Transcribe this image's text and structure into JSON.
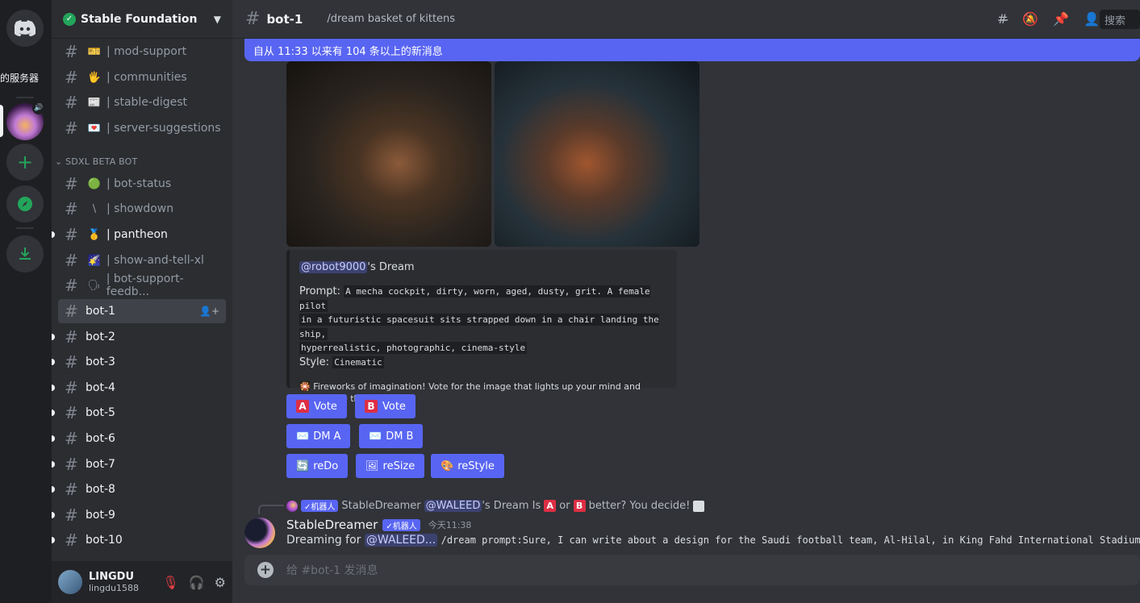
{
  "rail": {
    "server_text": "的服务器"
  },
  "guild": {
    "name": "Stable Foundation"
  },
  "channels_top": [
    {
      "emoji": "🎫",
      "name": "| mod-support"
    },
    {
      "emoji": "🖐",
      "name": "| communities"
    },
    {
      "emoji": "📰",
      "name": "| stable-digest"
    },
    {
      "emoji": "💌",
      "name": "| server-suggestions"
    }
  ],
  "category": "SDXL BETA BOT",
  "channels_bot": [
    {
      "emoji": "🟢",
      "name": "| bot-status"
    },
    {
      "emoji": "\\",
      "name": "| showdown"
    },
    {
      "emoji": "🥇",
      "name": "| pantheon"
    },
    {
      "emoji": "🌠",
      "name": "| show-and-tell-xl"
    },
    {
      "emoji": "🗣",
      "name": "| bot-support-feedb..."
    }
  ],
  "channels_numbered": [
    "bot-1",
    "bot-2",
    "bot-3",
    "bot-4",
    "bot-5",
    "bot-6",
    "bot-7",
    "bot-8",
    "bot-9",
    "bot-10"
  ],
  "user": {
    "name": "LINGDU",
    "handle": "lingdu1588"
  },
  "topbar": {
    "channel": "bot-1",
    "topic": "/dream basket of kittens",
    "search_placeholder": "搜索"
  },
  "new_messages": "自从 11:33 以来有 104 条以上的新消息",
  "embed": {
    "mention": "@robot9000",
    "title_suffix": "'s Dream",
    "prompt_label": "Prompt:",
    "prompt_lines": [
      "A mecha cockpit, dirty, worn, aged, dusty, grit. A female pilot",
      "in a futuristic spacesuit sits strapped down in a chair landing the ship,",
      "hyperrealistic, photographic, cinema-style"
    ],
    "style_label": "Style:",
    "style_value": "Cinematic",
    "description": "🎇 Fireworks of imagination! Vote for the image that lights up your mind and follows the theme! 💥"
  },
  "buttons": {
    "vote_a_letter": "A",
    "vote_a": "Vote",
    "vote_b_letter": "B",
    "vote_b": "Vote",
    "dm_a": "DM A",
    "dm_b": "DM B",
    "redo": "reDo",
    "resize": "reSize",
    "restyle": "reStyle"
  },
  "reply": {
    "bot_badge": "✓机器人",
    "author": "StableDreamer",
    "mention": "@WALEED",
    "text1": "'s Dream Is",
    "a": "A",
    "or": "or",
    "b": "B",
    "text2": "better? You decide!"
  },
  "message": {
    "author": "StableDreamer",
    "bot_badge": "✓机器人",
    "timestamp": "今天11:38",
    "prefix": "Dreaming for",
    "mention": "@WALEED...",
    "body": "/dream prompt:Sure, I can write about a design for the Saudi football team, Al-Hilal, in King Fahd International Stadium along"
  },
  "composer": {
    "placeholder": "给 #bot-1 发消息"
  }
}
